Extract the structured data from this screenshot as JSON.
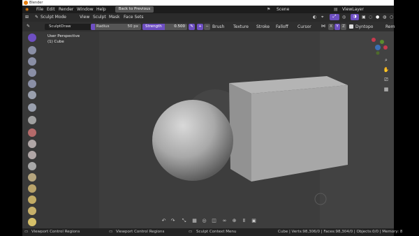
{
  "window_title": "Blender",
  "menu": {
    "items": [
      "File",
      "Edit",
      "Render",
      "Window",
      "Help"
    ],
    "back_button": "Back to Previous",
    "scene": "Scene",
    "view_layer": "ViewLayer"
  },
  "header": {
    "mode": "Sculpt Mode",
    "items": [
      "View",
      "Sculpt",
      "Mask",
      "Face Sets"
    ]
  },
  "tool_settings": {
    "brush_name": "SculptDraw",
    "radius_label": "Radius",
    "radius_value": "50 px",
    "strength_label": "Strength",
    "strength_value": "0.500",
    "strength_level": 0.5,
    "dropdowns": [
      "Brush",
      "Texture",
      "Stroke",
      "Falloff",
      "Cursor"
    ],
    "axes": [
      "X",
      "Y",
      "Z"
    ],
    "dyntopo": "Dyntopo",
    "remesh": "Rem"
  },
  "viewport": {
    "view_name": "User Perspective",
    "object_name": "(1) Cube"
  },
  "status": {
    "left1": "Viewport Control Regions",
    "left2": "Viewport Control Regions",
    "left3": "Sculpt Context Menu",
    "stats": "Cube | Verts:98,306/0 | Faces:98,304/0 | Objects:0/0 | Memory: 8"
  },
  "colors": {
    "accent": "#6e4fc2",
    "window_bg": "#3d3d3d",
    "header_bg": "#2b2b2b"
  }
}
